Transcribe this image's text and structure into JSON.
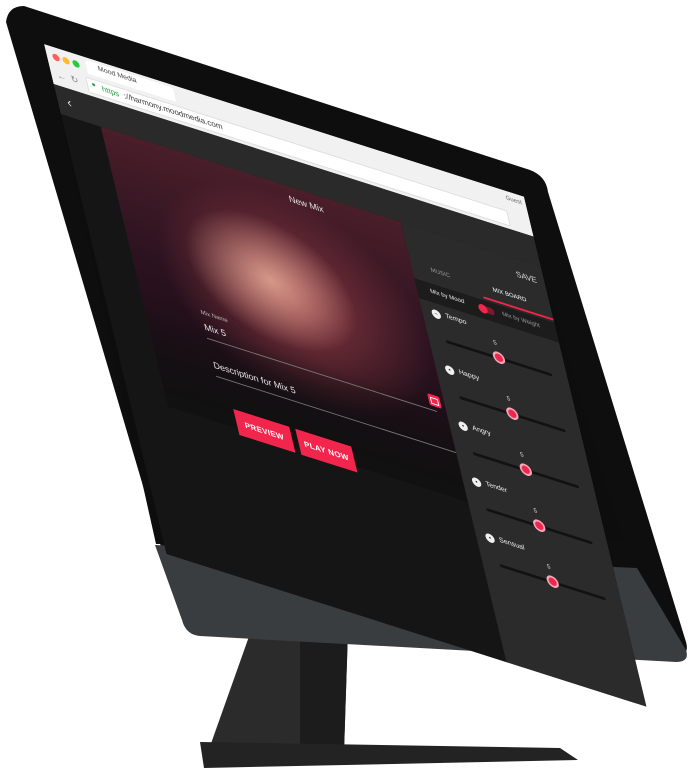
{
  "browser": {
    "tab_title": "Mood Media",
    "url_scheme": "https",
    "url_rest": "://harmony.moodmedia.com",
    "menu_label": "Guest"
  },
  "app": {
    "back_icon": "chevron-left-icon",
    "title": "New Mix",
    "save_label": "SAVE"
  },
  "form": {
    "mix_name_label": "Mix Name",
    "mix_name_value": "Mix 5",
    "description_value": "Description for Mix 5",
    "preview_label": "PREVIEW",
    "play_now_label": "PLAY NOW"
  },
  "panel": {
    "tabs": [
      {
        "label": "MUSIC",
        "active": false
      },
      {
        "label": "MIX BOARD",
        "active": true
      }
    ],
    "toggle": {
      "left_label": "Mix by Mood",
      "right_label": "Mix by Weight",
      "on": true
    },
    "sliders": [
      {
        "label": "Tempo",
        "icon": "tempo-icon",
        "value": "5",
        "level": 0.5
      },
      {
        "label": "Happy",
        "icon": "happy-face-icon",
        "value": "5",
        "level": 0.5
      },
      {
        "label": "Angry",
        "icon": "angry-face-icon",
        "value": "5",
        "level": 0.5
      },
      {
        "label": "Tender",
        "icon": "tender-face-icon",
        "value": "5",
        "level": 0.5
      },
      {
        "label": "Sensual",
        "icon": "sensual-face-icon",
        "value": "5",
        "level": 0.5
      }
    ]
  },
  "colors": {
    "accent": "#f2254c",
    "screen_bg": "#111111",
    "panel_bg": "#2b2b2b",
    "chrome_bg": "#f1f1f1"
  }
}
